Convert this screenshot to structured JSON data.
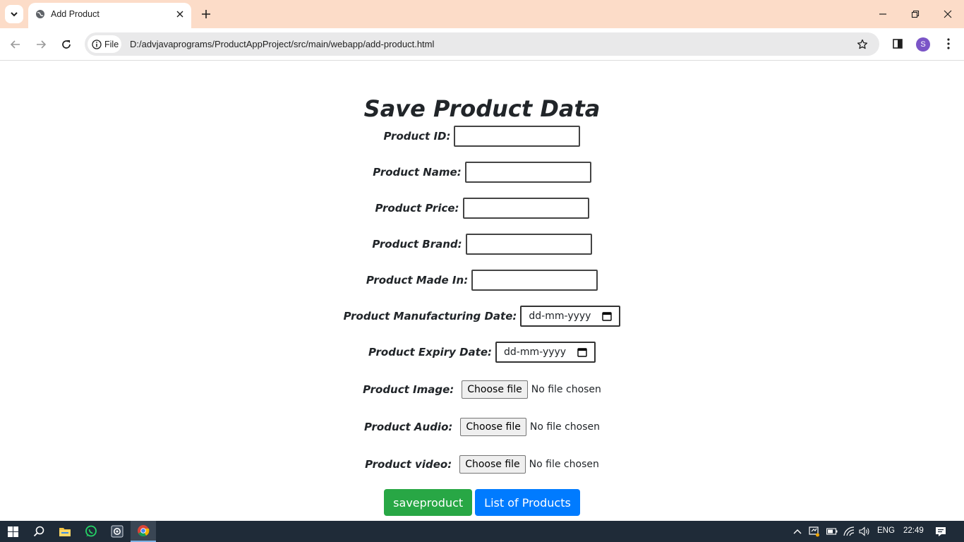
{
  "browser": {
    "tab_title": "Add Product",
    "chip_label": "File",
    "url": "D:/advjavaprograms/ProductAppProject/src/main/webapp/add-product.html",
    "avatar_letter": "S",
    "icons": [
      "tab-search-icon",
      "globe-icon",
      "close-icon",
      "plus-icon",
      "minimize-icon",
      "restore-icon",
      "window-close-icon",
      "back-arrow-icon",
      "forward-arrow-icon",
      "reload-icon",
      "info-icon",
      "star-icon",
      "side-panel-icon",
      "kebab-menu-icon"
    ]
  },
  "page": {
    "title": "Save Product Data",
    "fields": {
      "id_label": "Product ID:",
      "name_label": "Product Name:",
      "price_label": "Product Price:",
      "brand_label": "Product Brand:",
      "madein_label": "Product Made In:",
      "mfg_label": "Product Manufacturing Date:",
      "mfg_placeholder": "dd-mm-yyyy",
      "expiry_label": "Product Expiry Date:",
      "expiry_placeholder": "dd-mm-yyyy",
      "image_label": "Product Image:",
      "audio_label": "Product Audio:",
      "video_label": "Product video:",
      "choose_file": "Choose file",
      "no_file": "No file chosen"
    },
    "buttons": {
      "save": "saveproduct",
      "list": "List of Products"
    },
    "colors": {
      "save_button": "#28a745",
      "list_button": "#007bff",
      "titlebar": "#fcdcc8"
    }
  },
  "taskbar": {
    "language": "ENG",
    "time": "22:49",
    "icons": [
      "windows-start-icon",
      "search-icon",
      "file-explorer-icon",
      "whatsapp-icon",
      "settings-app-icon",
      "chrome-icon",
      "chevron-up-icon",
      "network-alert-icon",
      "battery-icon",
      "wifi-icon",
      "volume-icon",
      "notification-icon"
    ]
  }
}
